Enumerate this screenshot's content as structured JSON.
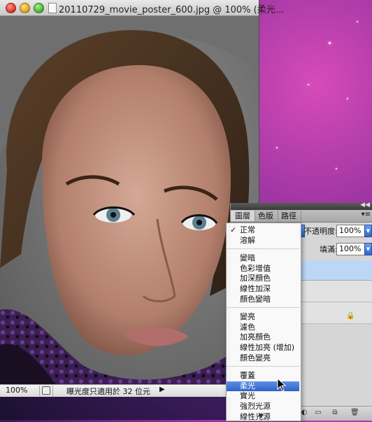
{
  "window": {
    "title": "20110729_movie_poster_600.jpg @ 100% (柔光..."
  },
  "status_bar": {
    "zoom": "100%",
    "info": "曝光度只適用於 32 位元"
  },
  "layers_panel": {
    "tabs": [
      {
        "label": "圖層",
        "active": true
      },
      {
        "label": "色版",
        "active": false
      },
      {
        "label": "路徑",
        "active": false
      }
    ],
    "opacity_label": "不透明度:",
    "opacity_value": "100%",
    "fill_label": "填滿:",
    "fill_value": "100%"
  },
  "blend_menu": {
    "groups": [
      [
        "正常",
        "溶解"
      ],
      [
        "變暗",
        "色彩增值",
        "加深顏色",
        "線性加深",
        "顏色變暗"
      ],
      [
        "變亮",
        "濾色",
        "加亮顏色",
        "線性加亮 (增加)",
        "顏色變亮"
      ],
      [
        "覆蓋",
        "柔光",
        "實光",
        "強烈光源",
        "線性光源"
      ]
    ],
    "checked": "正常",
    "selected": "柔光"
  },
  "colors": {
    "selection": "#2f62c8",
    "desktop": "#8c2f9c"
  }
}
